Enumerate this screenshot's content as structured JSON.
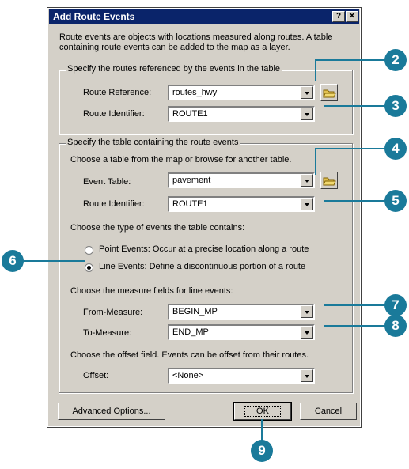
{
  "window": {
    "title": "Add Route Events",
    "help_button": "?",
    "close_button": "✕"
  },
  "intro": "Route events are objects with locations measured along routes. A table containing route events can be added to the map as a layer.",
  "routes_group": {
    "legend": "Specify the routes referenced by the events in the table",
    "route_reference_label": "Route Reference:",
    "route_reference_value": "routes_hwy",
    "route_identifier_label": "Route Identifier:",
    "route_identifier_value": "ROUTE1"
  },
  "table_group": {
    "legend": "Specify the table containing the route events",
    "choose_table_text": "Choose a table from the map or browse for another table.",
    "event_table_label": "Event Table:",
    "event_table_value": "pavement",
    "route_identifier_label": "Route Identifier:",
    "route_identifier_value": "ROUTE1",
    "event_type_text": "Choose the type of events the table contains:",
    "point_events_label": "Point Events: Occur at a precise location along a route",
    "line_events_label": "Line Events: Define a discontinuous portion of a route",
    "measure_text": "Choose the measure fields for line events:",
    "from_measure_label": "From-Measure:",
    "from_measure_value": "BEGIN_MP",
    "to_measure_label": "To-Measure:",
    "to_measure_value": "END_MP",
    "offset_text": "Choose the offset field. Events can be offset from their routes.",
    "offset_label": "Offset:",
    "offset_value": "<None>"
  },
  "buttons": {
    "advanced": "Advanced Options...",
    "ok": "OK",
    "cancel": "Cancel"
  },
  "callouts": {
    "c2": "2",
    "c3": "3",
    "c4": "4",
    "c5": "5",
    "c6": "6",
    "c7": "7",
    "c8": "8",
    "c9": "9"
  },
  "colors": {
    "callout": "#1a7a9a",
    "titlebar": "#0a246a"
  }
}
